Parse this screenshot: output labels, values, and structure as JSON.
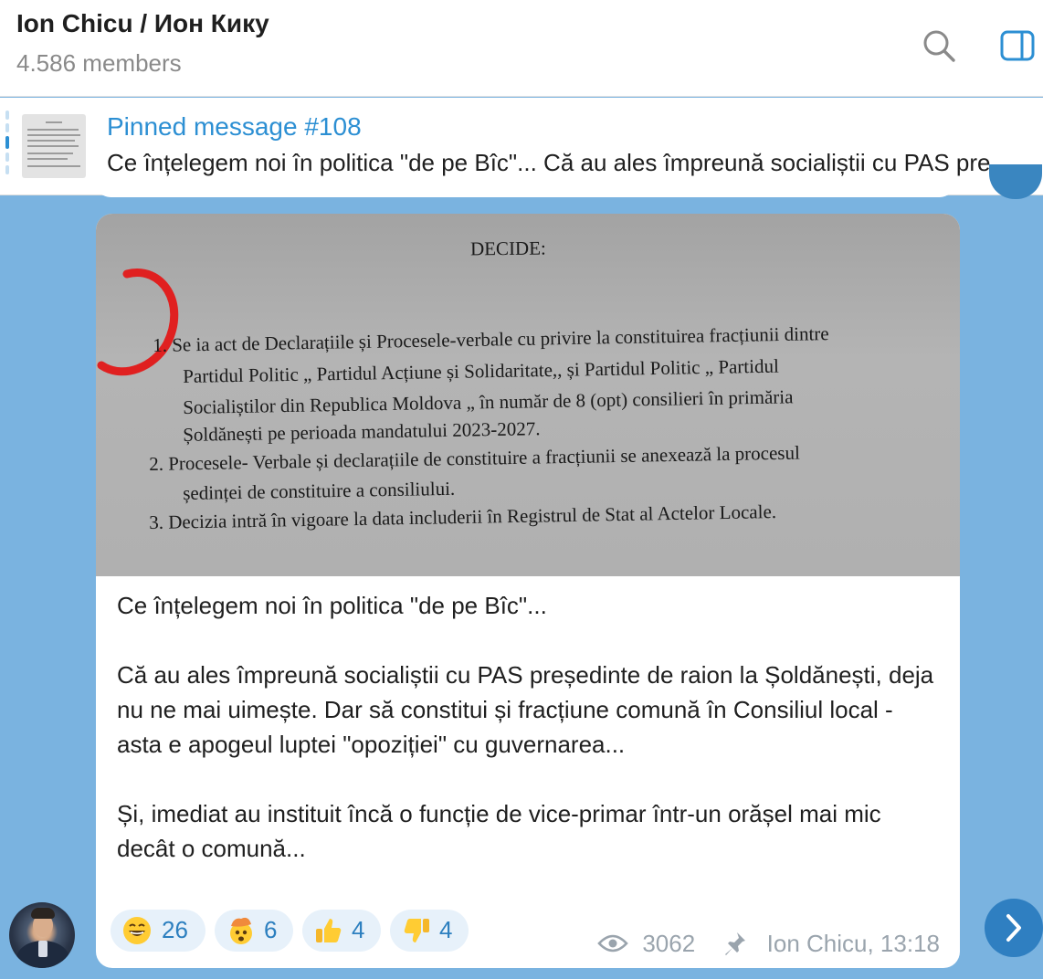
{
  "header": {
    "title": "Ion Chicu / Ион Кику",
    "members": "4.586 members",
    "search_icon": "search-icon",
    "panel_icon": "side-panel-icon"
  },
  "pinned": {
    "label": "Pinned message #108",
    "preview": "Ce înțelegem noi în politica \"de pe Bîc\"...  Că au ales împreună socialiștii cu PAS președinte de raion la Șoldănești"
  },
  "document": {
    "title": "DECIDE:",
    "lines": [
      "1.  Se ia act de Declarațiile și Procesele-verbale  cu privire la constituirea fracțiunii dintre",
      "Partidul  Politic „ Partidul Acțiune și Solidaritate,, și  Partidul Politic „ Partidul",
      "Socialiștilor din Republica Moldova „ în număr de 8 (opt) consilieri în primăria",
      "Șoldănești pe perioada mandatului  2023-2027.",
      "2.  Procesele- Verbale și declarațiile de constituire a fracțiunii se anexează la procesul",
      "ședinței de constituire a consiliului.",
      "3.  Decizia intră în vigoare la data includerii în Registrul de Stat al Actelor Locale."
    ]
  },
  "message": {
    "p1": "Ce înțelegem noi în politica \"de pe Bîc\"...",
    "p2": "Că au ales împreună socialiștii cu PAS președinte de raion la Șoldănești, deja nu ne mai uimește. Dar să constitui și fracțiune comună în Consiliul local - asta e apogeul luptei \"opoziției\" cu guvernarea...",
    "p3": "Și, imediat au instituit încă o funcție de vice-primar într-un orășel mai mic decât o comună..."
  },
  "reactions": [
    {
      "icon": "grinning-face-icon",
      "count": "26"
    },
    {
      "icon": "exploding-head-icon",
      "count": "6"
    },
    {
      "icon": "thumbs-up-icon",
      "count": "4"
    },
    {
      "icon": "thumbs-down-icon",
      "count": "4"
    }
  ],
  "meta": {
    "views": "3062",
    "author_time": "Ion Chicu, 13:18",
    "views_icon": "eye-icon",
    "pin_icon": "pin-icon"
  },
  "colors": {
    "background": "#7ab3e0",
    "accent": "#2c8fd3",
    "reaction_bg": "#e7f1fa",
    "reaction_text": "#2c7fbf",
    "meta_text": "#9aa4ad"
  }
}
